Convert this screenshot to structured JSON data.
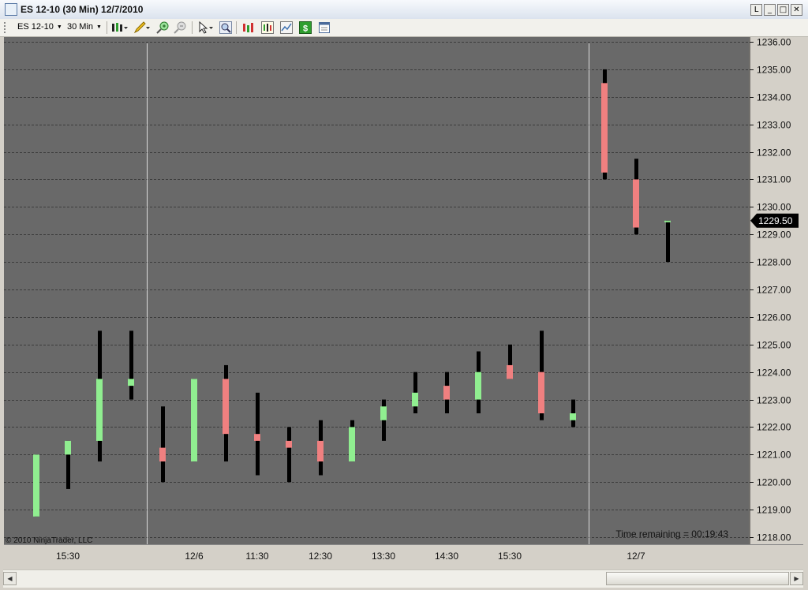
{
  "window": {
    "title": "ES 12-10 (30 Min)  12/7/2010",
    "buttons": {
      "restore_tab": "L",
      "minimize": "_",
      "maximize": "□",
      "close": "✕"
    }
  },
  "toolbar": {
    "instrument": "ES 12-10",
    "interval": "30 Min",
    "icons": [
      "bar-type-icon",
      "drawing-pencil-icon",
      "zoom-in-icon",
      "zoom-out-icon",
      "cursor-pointer-icon",
      "search-magnifier-icon",
      "indicators-icon",
      "strategies-icon",
      "chart-properties-icon",
      "dollar-icon",
      "data-box-icon"
    ]
  },
  "chart": {
    "copyright": "© 2010 NinjaTrader, LLC",
    "time_remaining": "Time remaining = 00:19:43",
    "last_price_label": "1229.50",
    "colors": {
      "background": "#696969",
      "up": "#90ee90",
      "down": "#f08080",
      "wick": "#000000",
      "grid": "#3c3c3c",
      "session_line": "#dcdcdc"
    }
  },
  "chart_data": {
    "type": "candlestick",
    "ylim": [
      1218.0,
      1236.0
    ],
    "y_ticks": [
      "1236.00",
      "1235.00",
      "1234.00",
      "1233.00",
      "1232.00",
      "1231.00",
      "1230.00",
      "1229.00",
      "1228.00",
      "1227.00",
      "1226.00",
      "1225.00",
      "1224.00",
      "1223.00",
      "1222.00",
      "1221.00",
      "1220.00",
      "1219.00",
      "1218.00"
    ],
    "x_labels": [
      {
        "bar": 1,
        "label": "15:30"
      },
      {
        "bar": 5,
        "label": "12/6"
      },
      {
        "bar": 7,
        "label": "11:30"
      },
      {
        "bar": 9,
        "label": "12:30"
      },
      {
        "bar": 11,
        "label": "13:30"
      },
      {
        "bar": 13,
        "label": "14:30"
      },
      {
        "bar": 15,
        "label": "15:30"
      },
      {
        "bar": 19,
        "label": "12/7"
      }
    ],
    "session_breaks_after_bar": [
      3,
      17
    ],
    "bars": [
      {
        "open": 1218.75,
        "high": 1221.0,
        "low": 1218.75,
        "close": 1221.0
      },
      {
        "open": 1221.0,
        "high": 1221.5,
        "low": 1219.75,
        "close": 1221.5
      },
      {
        "open": 1221.5,
        "high": 1225.5,
        "low": 1220.75,
        "close": 1223.75
      },
      {
        "open": 1223.5,
        "high": 1225.5,
        "low": 1223.0,
        "close": 1223.75
      },
      {
        "open": 1221.25,
        "high": 1222.75,
        "low": 1220.0,
        "close": 1220.75
      },
      {
        "open": 1220.75,
        "high": 1223.75,
        "low": 1220.75,
        "close": 1223.75
      },
      {
        "open": 1223.75,
        "high": 1224.25,
        "low": 1220.75,
        "close": 1221.75
      },
      {
        "open": 1221.75,
        "high": 1223.25,
        "low": 1220.25,
        "close": 1221.5
      },
      {
        "open": 1221.5,
        "high": 1222.0,
        "low": 1220.0,
        "close": 1221.25
      },
      {
        "open": 1221.5,
        "high": 1222.25,
        "low": 1220.25,
        "close": 1220.75
      },
      {
        "open": 1220.75,
        "high": 1222.25,
        "low": 1220.75,
        "close": 1222.0
      },
      {
        "open": 1222.25,
        "high": 1223.0,
        "low": 1221.5,
        "close": 1222.75
      },
      {
        "open": 1222.75,
        "high": 1224.0,
        "low": 1222.5,
        "close": 1223.25
      },
      {
        "open": 1223.5,
        "high": 1224.0,
        "low": 1222.5,
        "close": 1223.0
      },
      {
        "open": 1223.0,
        "high": 1224.75,
        "low": 1222.5,
        "close": 1224.0
      },
      {
        "open": 1224.25,
        "high": 1225.0,
        "low": 1223.75,
        "close": 1223.75
      },
      {
        "open": 1224.0,
        "high": 1225.5,
        "low": 1222.25,
        "close": 1222.5
      },
      {
        "open": 1222.25,
        "high": 1223.0,
        "low": 1222.0,
        "close": 1222.5
      },
      {
        "open": 1234.5,
        "high": 1235.0,
        "low": 1231.0,
        "close": 1231.25
      },
      {
        "open": 1231.0,
        "high": 1231.75,
        "low": 1229.0,
        "close": 1229.25
      },
      {
        "open": 1229.5,
        "high": 1229.5,
        "low": 1228.0,
        "close": 1229.5
      }
    ]
  }
}
